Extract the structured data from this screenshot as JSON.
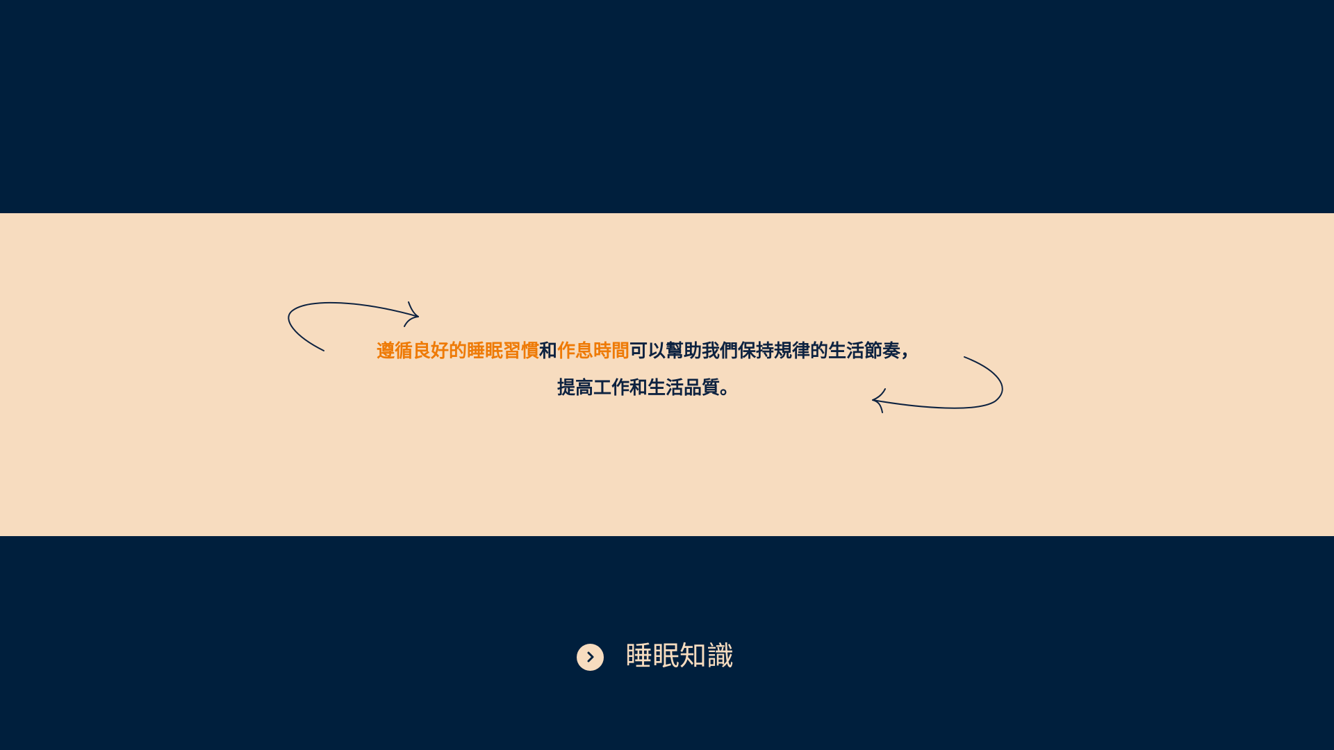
{
  "quote": {
    "line1": [
      {
        "text": "遵循良好的睡眠習慣",
        "highlight": true
      },
      {
        "text": "和",
        "highlight": false
      },
      {
        "text": "作息時間",
        "highlight": true
      },
      {
        "text": "可以幫助我們保持規律的生活節奏，",
        "highlight": false
      }
    ],
    "line2": "提高工作和生活品質。"
  },
  "nav": {
    "label": "睡眠知識",
    "icon": "chevron-right-icon"
  },
  "colors": {
    "background": "#001f3d",
    "band": "#f7dcbf",
    "highlight": "#ee7a06",
    "text": "#0d2240"
  }
}
